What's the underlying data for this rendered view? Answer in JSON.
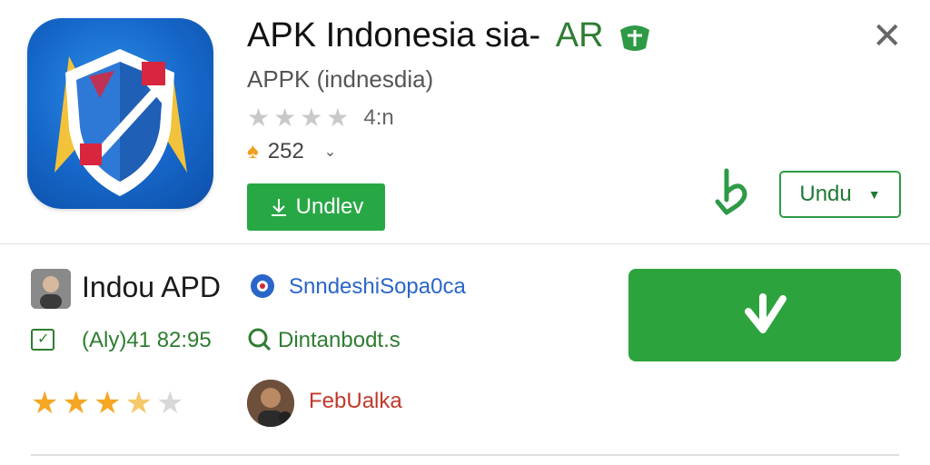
{
  "header": {
    "title": "APK Indonesia sia-",
    "title_accent": "AR",
    "subtitle": "APPK (indnesdia)",
    "rating_stars": "★★★★",
    "rating_value": "4:n",
    "download_count": "252",
    "install_button_label": "Undlev",
    "dropdown_label": "Undu",
    "close_glyph": "✕"
  },
  "details": {
    "developer_name": "Indou APD",
    "developer_link": "SnndeshiSopa0ca",
    "updated_date": "(Aly)41 82:95",
    "status_text": "Dintanbodt.s",
    "review_stars": {
      "filled": "★★★",
      "half": "★",
      "empty": "★"
    },
    "reviewer_name": "FebUalka"
  },
  "colors": {
    "primary_green": "#2da33e",
    "icon_blue": "#1566c8",
    "link_blue": "#2a65c9",
    "star_gold": "#f5a623",
    "reviewer_red": "#c0392b"
  }
}
